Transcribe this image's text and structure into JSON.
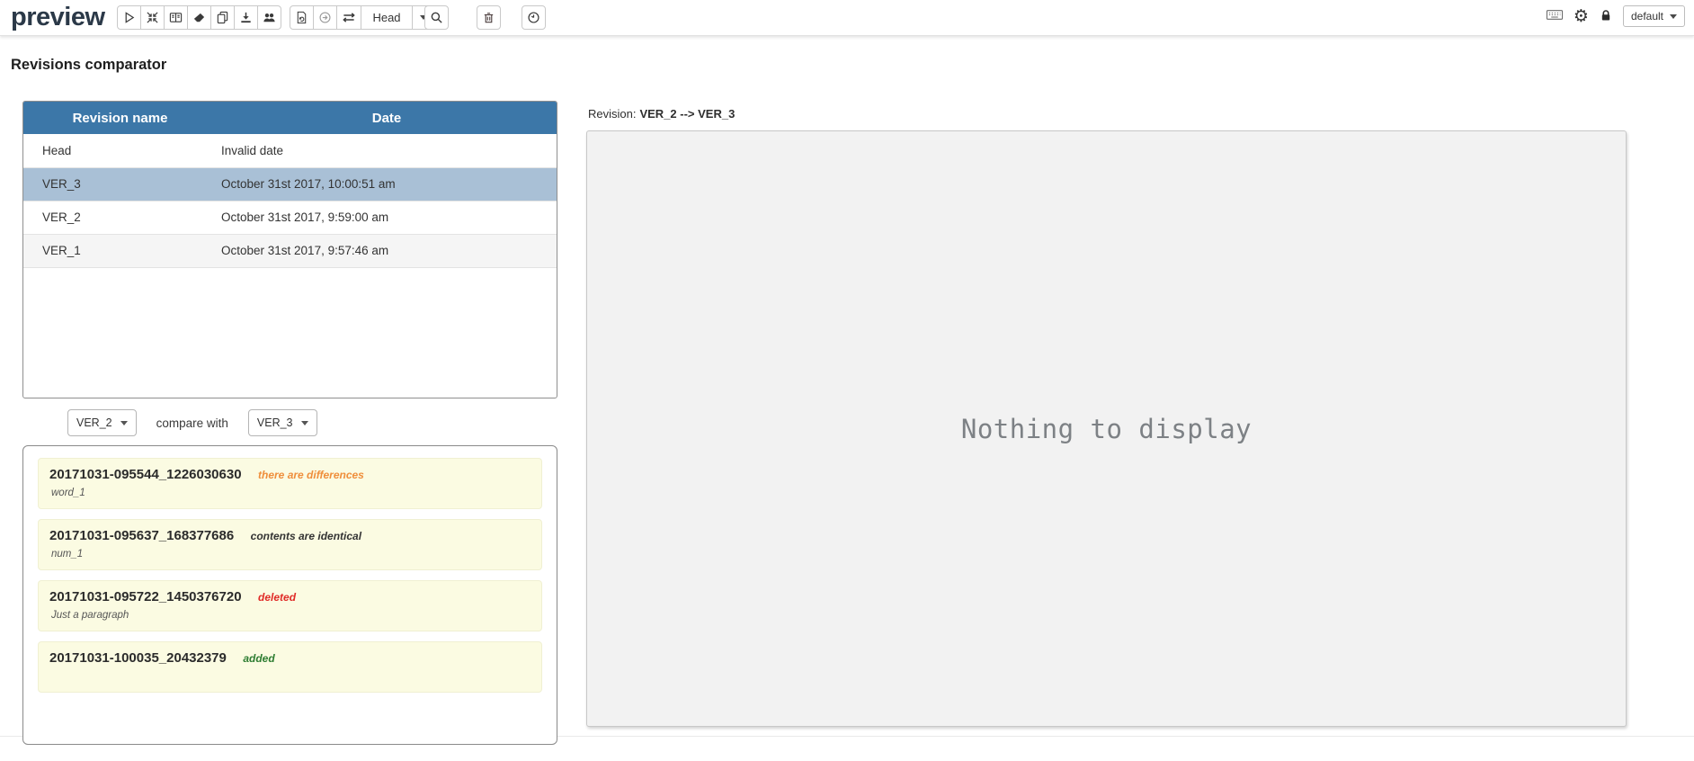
{
  "topbar": {
    "brand": "preview",
    "head_dropdown": "Head",
    "default_dropdown": "default",
    "icons": [
      "play-icon",
      "compress-icon",
      "book-icon",
      "eraser-icon",
      "copy-icon",
      "download-icon",
      "users-icon",
      "file-refresh-icon",
      "circle-arrow-right-icon",
      "exchange-icon",
      "search-icon",
      "trash-icon",
      "clock-icon",
      "keyboard-icon",
      "gear-icon",
      "lock-icon"
    ]
  },
  "title": "Revisions comparator",
  "table": {
    "col_name": "Revision name",
    "col_date": "Date",
    "rows": [
      {
        "name": "Head",
        "date": "Invalid date"
      },
      {
        "name": "VER_3",
        "date": "October 31st 2017, 10:00:51 am",
        "selected": true
      },
      {
        "name": "VER_2",
        "date": "October 31st 2017, 9:59:00 am"
      },
      {
        "name": "VER_1",
        "date": "October 31st 2017, 9:57:46 am"
      }
    ]
  },
  "compare": {
    "left": "VER_2",
    "label": "compare with",
    "right": "VER_3"
  },
  "docs": [
    {
      "id": "20171031-095544_1226030630",
      "status": "there are differences",
      "subtitle": "word_1"
    },
    {
      "id": "20171031-095637_168377686",
      "status": "contents are identical",
      "subtitle": "num_1"
    },
    {
      "id": "20171031-095722_1450376720",
      "status": "deleted",
      "subtitle": "Just a paragraph"
    },
    {
      "id": "20171031-100035_20432379",
      "status": "added",
      "subtitle": ""
    }
  ],
  "preview": {
    "label": "Revision:",
    "value": "VER_2 --> VER_3",
    "empty": "Nothing to display"
  },
  "colors": {
    "table_header_bg": "#3c77a8",
    "selected_row_bg": "#a9c0d6",
    "striped_row_bg": "#f5f5f5",
    "doc_item_bg": "#fbfbe2",
    "status_differences": "#ef8e3b",
    "status_identical": "#333333",
    "status_deleted": "#e02b27",
    "status_added": "#2e7d32",
    "empty_panel_bg": "#f2f2f2",
    "brand_color": "#2b3948"
  }
}
